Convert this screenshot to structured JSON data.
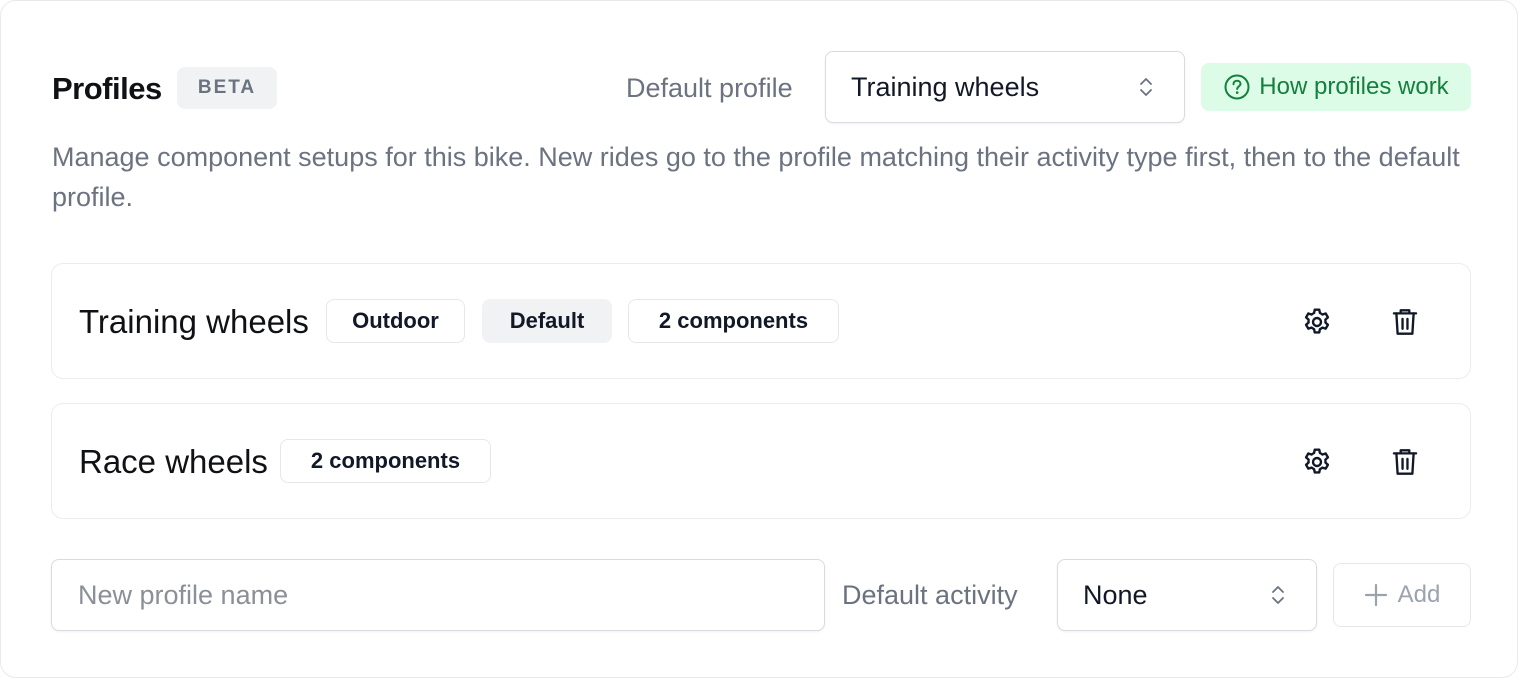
{
  "header": {
    "title": "Profiles",
    "badge": "BETA",
    "default_profile_label": "Default profile",
    "default_profile_value": "Training wheels",
    "help_button": "How profiles work"
  },
  "description": "Manage component setups for this bike. New rides go to the profile matching their activity type first, then to the default profile.",
  "profiles": [
    {
      "name": "Training wheels",
      "tags": [
        "Outdoor",
        "Default",
        "2 components"
      ]
    },
    {
      "name": "Race wheels",
      "tags": [
        "2 components"
      ]
    }
  ],
  "new_profile": {
    "name_placeholder": "New profile name",
    "activity_label": "Default activity",
    "activity_value": "None",
    "add_label": "Add"
  },
  "icons": {
    "select": "chevron-updown-icon",
    "help": "question-circle-icon",
    "settings": "gear-icon",
    "delete": "trash-icon",
    "add": "plus-icon"
  },
  "colors": {
    "accent_green_bg": "#dcfce7",
    "accent_green_text": "#15803d",
    "muted_text": "#6b7280"
  }
}
